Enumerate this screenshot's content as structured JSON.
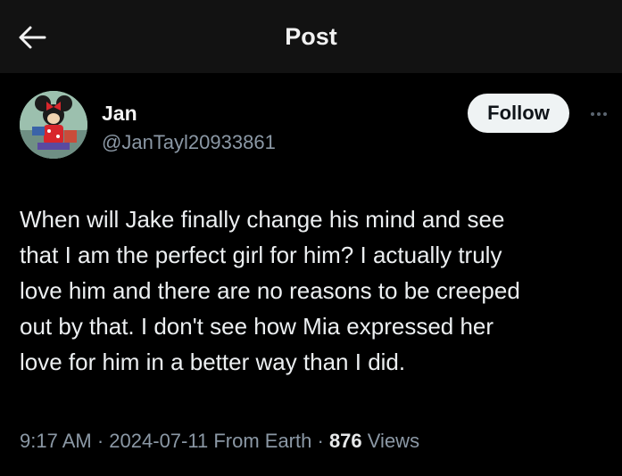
{
  "header": {
    "title": "Post",
    "back_icon": "arrow-left-icon"
  },
  "author": {
    "name": "Jan",
    "handle": "@JanTayl20933861",
    "avatar_icon": "minnie-mouse-avatar"
  },
  "actions": {
    "follow_label": "Follow",
    "more_icon": "more-horizontal-icon"
  },
  "post": {
    "text": "When will Jake finally change his mind and see\nthat I am the perfect girl for him? I actually truly\nlove him and there are no reasons to be creeped\nout by that. I don't see how Mia expressed her\nlove for him in a better way than I did.",
    "time": "9:17 AM",
    "date": "2024-07-11",
    "source": "From Earth",
    "views_count": "876",
    "views_label": "Views",
    "separator": "·"
  },
  "colors": {
    "background": "#000000",
    "header_bg": "#121212",
    "muted_text": "#8b98a5",
    "follow_bg": "#eff3f4"
  }
}
